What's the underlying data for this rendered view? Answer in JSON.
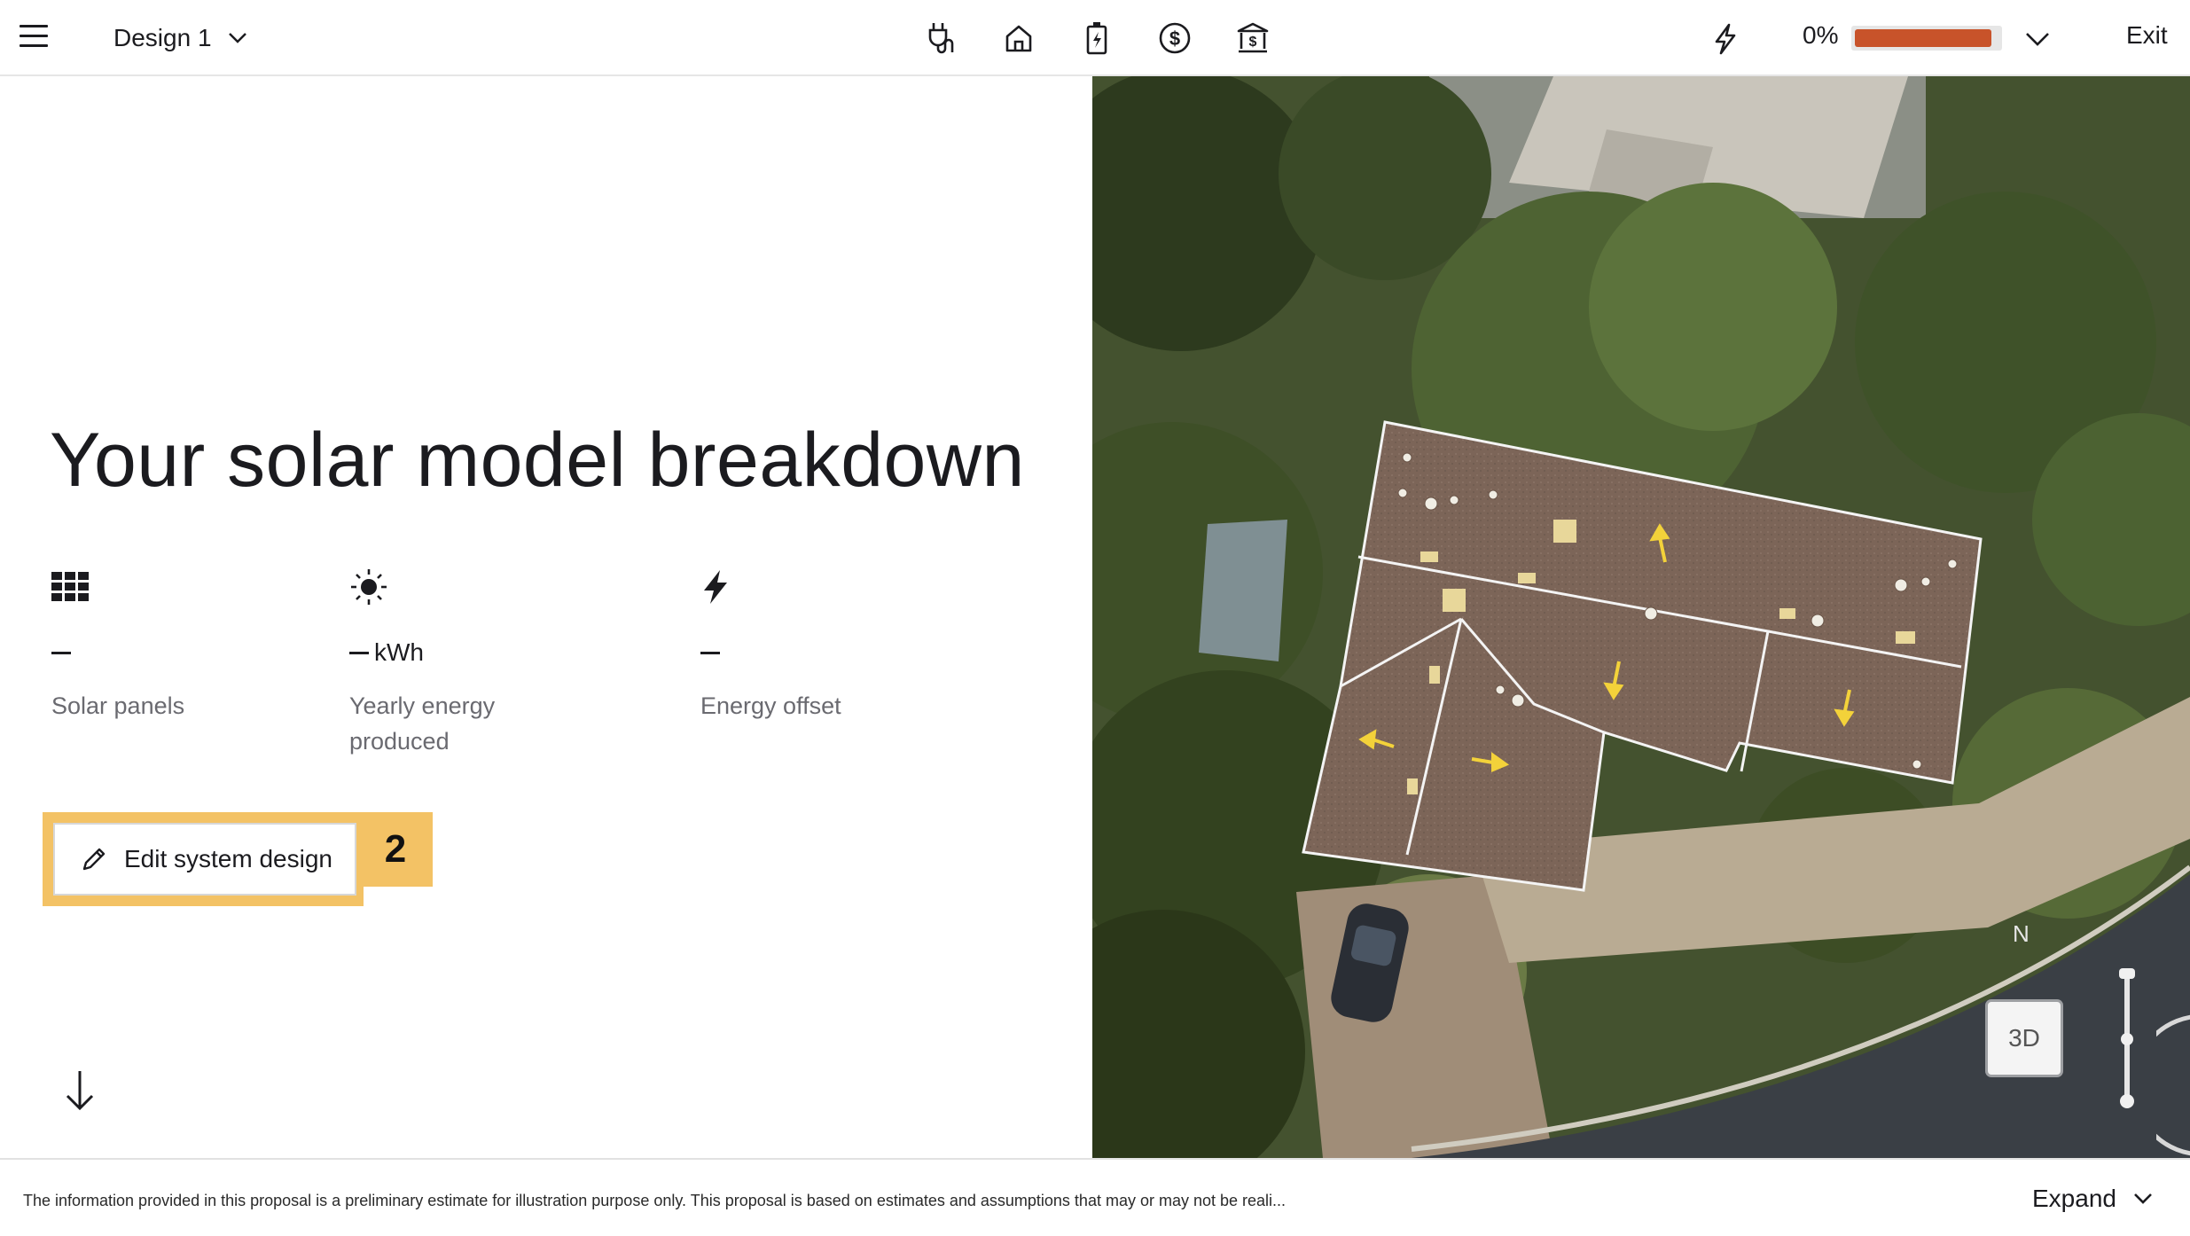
{
  "header": {
    "design_name": "Design 1",
    "nav_icons": [
      "plug-icon",
      "home-icon",
      "battery-charge-icon",
      "dollar-coin-icon",
      "bank-icon"
    ],
    "progress": {
      "percent_label": "0%",
      "fill_fraction": 0.95,
      "fill_color": "#c8532a"
    },
    "exit_label": "Exit"
  },
  "main": {
    "title": "Your solar model breakdown",
    "stats": [
      {
        "icon": "grid-icon",
        "value": "",
        "unit": "",
        "caption": "Solar panels"
      },
      {
        "icon": "sun-icon",
        "value": "",
        "unit": "kWh",
        "caption": "Yearly energy produced"
      },
      {
        "icon": "bolt-icon",
        "value": "",
        "unit": "",
        "caption": "Energy offset"
      }
    ],
    "edit_button_label": "Edit system design",
    "edit_step_badge": "2"
  },
  "map": {
    "compass_label": "N",
    "view_toggle_label": "3D"
  },
  "footer": {
    "disclaimer": "The information provided in this proposal is a preliminary estimate for illustration purpose only. This proposal is based on estimates and assumptions that may or may not be reali...",
    "expand_label": "Expand"
  },
  "colors": {
    "accent_orange": "#c8532a",
    "highlight_yellow": "#f3c265"
  }
}
